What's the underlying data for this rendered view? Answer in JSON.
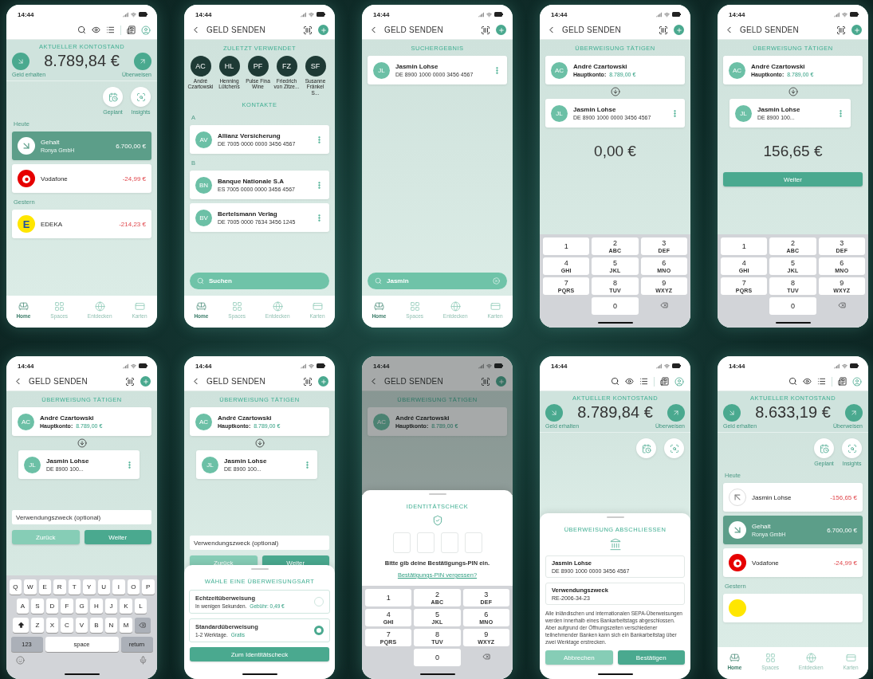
{
  "screens": [
    {
      "time": "14:44",
      "header": {
        "kind": "home"
      },
      "blocks": [
        {
          "kind": "balance",
          "label": "AKTUELLER KONTOSTAND",
          "amount": "8.789,84 €",
          "left_label": "Geld erhalten",
          "right_label": "Überweisen"
        },
        {
          "kind": "shortcuts",
          "items": [
            {
              "kind": "scheduled",
              "label": "Geplant"
            },
            {
              "kind": "insights",
              "label": "Insights"
            }
          ]
        },
        {
          "kind": "section_label",
          "text": "Heute"
        },
        {
          "kind": "transaction",
          "logo": {
            "kind": "arrow-in"
          },
          "name": "Gehalt",
          "sub": "Ronya GmbH",
          "amount": "6.700,00 €",
          "highlighted": true,
          "negative": false
        },
        {
          "kind": "transaction",
          "logo": {
            "kind": "vodafone"
          },
          "name": "Vodafone",
          "amount": "-24,99 €",
          "highlighted": false,
          "negative": true
        },
        {
          "kind": "section_label",
          "text": "Gestern"
        },
        {
          "kind": "transaction",
          "logo": {
            "kind": "edeka",
            "text": "E"
          },
          "name": "EDEKA",
          "amount": "-214,23 €",
          "highlighted": false,
          "negative": true
        }
      ],
      "tabbar": [
        {
          "label": "Home",
          "selected": true
        },
        {
          "label": "Spaces",
          "selected": false
        },
        {
          "label": "Entdecken",
          "selected": false
        },
        {
          "label": "Karten",
          "selected": false
        }
      ]
    },
    {
      "time": "14:44",
      "header": {
        "kind": "send",
        "title": "GELD SENDEN"
      },
      "blocks": [
        {
          "kind": "heading",
          "text": "ZULETZT VERWENDET"
        },
        {
          "kind": "recent",
          "items": [
            {
              "initials": "AC",
              "name": "André Czartowski"
            },
            {
              "initials": "HL",
              "name": "Henning Lütchens"
            },
            {
              "initials": "PF",
              "name": "Pulse Fina Wine"
            },
            {
              "initials": "FZ",
              "name": "Friedrich von Zitze..."
            },
            {
              "initials": "SF",
              "name": "Susanne Fränkel S..."
            }
          ]
        },
        {
          "kind": "heading",
          "text": "KONTAKTE"
        },
        {
          "kind": "section_label",
          "text": "A"
        },
        {
          "kind": "contact",
          "initials": "AV",
          "name": "Allianz Versicherung",
          "iban": "DE 7005 0000 0000 3456 4567",
          "menu": true,
          "indented": false
        },
        {
          "kind": "section_label",
          "text": "B"
        },
        {
          "kind": "contact",
          "initials": "BN",
          "name": "Banque Nationale S.A",
          "iban": "ES 7005 0000 0000 3456 4567",
          "menu": true,
          "indented": false
        },
        {
          "kind": "contact",
          "initials": "BV",
          "name": "Bertelsmann Verlag",
          "iban": "DE 7005 0000 7634 3456 1245",
          "menu": true,
          "indented": false
        },
        {
          "kind": "search",
          "placeholder": "Suchen"
        }
      ],
      "tabbar": [
        {
          "label": "Home",
          "selected": true
        },
        {
          "label": "Spaces",
          "selected": false
        },
        {
          "label": "Entdecken",
          "selected": false
        },
        {
          "label": "Karten",
          "selected": false
        }
      ]
    },
    {
      "time": "14:44",
      "header": {
        "kind": "send",
        "title": "GELD SENDEN"
      },
      "blocks": [
        {
          "kind": "heading",
          "text": "SUCHERGEBNIS"
        },
        {
          "kind": "contact",
          "initials": "JL",
          "name": "Jasmin Lohse",
          "iban": "DE 8900 1000 0000 3456 4567",
          "menu": true,
          "indented": false
        },
        {
          "kind": "search",
          "value": "Jasmin"
        }
      ],
      "tabbar": [
        {
          "label": "Home",
          "selected": true
        },
        {
          "label": "Spaces",
          "selected": false
        },
        {
          "label": "Entdecken",
          "selected": false
        },
        {
          "label": "Karten",
          "selected": false
        }
      ]
    },
    {
      "time": "14:44",
      "header": {
        "kind": "send",
        "title": "GELD SENDEN"
      },
      "blocks": [
        {
          "kind": "heading",
          "text": "ÜBERWEISUNG TÄTIGEN"
        },
        {
          "kind": "contact",
          "initials": "AC",
          "name": "André Czartowski",
          "account_label": "Hauptkonto:",
          "account_value": "8.789,00 €",
          "menu": false,
          "indented": false
        },
        {
          "kind": "swap"
        },
        {
          "kind": "contact",
          "initials": "JL",
          "name": "Jasmin Lohse",
          "iban": "DE 8900 1000 0000 3456 4567",
          "menu": true,
          "indented": false
        },
        {
          "kind": "amount",
          "text": "0,00 €"
        },
        {
          "kind": "numpad",
          "keys": [
            {
              "digit": "1"
            },
            {
              "digit": "2",
              "letters": "ABC"
            },
            {
              "digit": "3",
              "letters": "DEF"
            },
            {
              "digit": "4",
              "letters": "GHI"
            },
            {
              "digit": "5",
              "letters": "JKL"
            },
            {
              "digit": "6",
              "letters": "MNO"
            },
            {
              "digit": "7",
              "letters": "PQRS"
            },
            {
              "digit": "8",
              "letters": "TUV"
            },
            {
              "digit": "9",
              "letters": "WXYZ"
            },
            {
              "digit": "0"
            }
          ]
        }
      ]
    },
    {
      "time": "14:44",
      "header": {
        "kind": "send",
        "title": "GELD SENDEN"
      },
      "blocks": [
        {
          "kind": "heading",
          "text": "ÜBERWEISUNG TÄTIGEN"
        },
        {
          "kind": "contact",
          "initials": "AC",
          "name": "André Czartowski",
          "account_label": "Hauptkonto:",
          "account_value": "8.789,00 €",
          "menu": false,
          "indented": false
        },
        {
          "kind": "swap"
        },
        {
          "kind": "contact",
          "initials": "JL",
          "name": "Jasmin Lohse",
          "iban": "DE 8900 100...",
          "menu": true,
          "indented": true
        },
        {
          "kind": "amount",
          "text": "156,65 €"
        },
        {
          "kind": "button",
          "label": "Weiter"
        },
        {
          "kind": "numpad",
          "keys": [
            {
              "digit": "1"
            },
            {
              "digit": "2",
              "letters": "ABC"
            },
            {
              "digit": "3",
              "letters": "DEF"
            },
            {
              "digit": "4",
              "letters": "GHI"
            },
            {
              "digit": "5",
              "letters": "JKL"
            },
            {
              "digit": "6",
              "letters": "MNO"
            },
            {
              "digit": "7",
              "letters": "PQRS"
            },
            {
              "digit": "8",
              "letters": "TUV"
            },
            {
              "digit": "9",
              "letters": "WXYZ"
            },
            {
              "digit": "0"
            }
          ]
        }
      ]
    },
    {
      "time": "14:44",
      "header": {
        "kind": "send",
        "title": "GELD SENDEN"
      },
      "blocks": [
        {
          "kind": "heading",
          "text": "ÜBERWEISUNG TÄTIGEN"
        },
        {
          "kind": "contact",
          "initials": "AC",
          "name": "André Czartowski",
          "account_label": "Hauptkonto:",
          "account_value": "8.789,00 €",
          "menu": false,
          "indented": false
        },
        {
          "kind": "swap"
        },
        {
          "kind": "contact",
          "initials": "JL",
          "name": "Jasmin Lohse",
          "iban": "DE 8900 100...",
          "menu": true,
          "indented": true
        },
        {
          "kind": "field",
          "placeholder": "Verwendungszweck (optional)"
        },
        {
          "kind": "buttons",
          "items": [
            {
              "label": "Zurück",
              "primary": false
            },
            {
              "label": "Weiter",
              "primary": true
            }
          ]
        },
        {
          "kind": "keyboard",
          "rows": [
            [
              "Q",
              "W",
              "E",
              "R",
              "T",
              "Y",
              "U",
              "I",
              "O",
              "P"
            ],
            [
              "A",
              "S",
              "D",
              "F",
              "G",
              "H",
              "J",
              "K",
              "L"
            ],
            [
              "Z",
              "X",
              "C",
              "V",
              "B",
              "N",
              "M"
            ]
          ],
          "numbers": "123",
          "space": "space",
          "return": "return"
        }
      ]
    },
    {
      "time": "14:44",
      "header": {
        "kind": "send",
        "title": "GELD SENDEN"
      },
      "blocks": [
        {
          "kind": "heading",
          "text": "ÜBERWEISUNG TÄTIGEN"
        },
        {
          "kind": "contact",
          "initials": "AC",
          "name": "André Czartowski",
          "account_label": "Hauptkonto:",
          "account_value": "8.789,00 €",
          "menu": false,
          "indented": false
        },
        {
          "kind": "swap"
        },
        {
          "kind": "contact",
          "initials": "JL",
          "name": "Jasmin Lohse",
          "iban": "DE 8900 100...",
          "menu": true,
          "indented": true
        },
        {
          "kind": "field",
          "placeholder": "Verwendungszweck (optional)"
        },
        {
          "kind": "buttons",
          "items": [
            {
              "label": "Zurück",
              "primary": false
            },
            {
              "label": "Weiter",
              "primary": true
            }
          ]
        }
      ],
      "sheet": {
        "blocks": [
          {
            "kind": "heading",
            "text": "WÄHLE EINE ÜBERWEISUNGSART"
          },
          {
            "kind": "options",
            "items": [
              {
                "title": "Echtzeitüberweisung",
                "desc": "In wenigen Sekunden.",
                "note": "Gebühr: 0,49 €",
                "selected": false
              },
              {
                "title": "Standardüberweisung",
                "desc": "1-2 Werktage.",
                "note": "Gratis",
                "selected": true
              }
            ]
          },
          {
            "kind": "button",
            "label": "Zum Identitätscheck"
          }
        ]
      }
    },
    {
      "time": "14:44",
      "dimmed": true,
      "header": {
        "kind": "send",
        "title": "GELD SENDEN"
      },
      "blocks": [
        {
          "kind": "heading",
          "text": "ÜBERWEISUNG TÄTIGEN"
        },
        {
          "kind": "contact",
          "initials": "AC",
          "name": "André Czartowski",
          "account_label": "Hauptkonto:",
          "account_value": "8.789,00 €",
          "menu": false,
          "indented": false
        }
      ],
      "sheet": {
        "blocks": [
          {
            "kind": "heading",
            "text": "IDENTITÄTSCHECK"
          },
          {
            "kind": "shield"
          },
          {
            "kind": "pin",
            "fields": [
              {
                "filled": false
              },
              {
                "filled": false
              },
              {
                "filled": false
              },
              {
                "filled": false
              }
            ]
          },
          {
            "kind": "text",
            "text": "Bitte gib deine Bestätigungs-PIN ein."
          },
          {
            "kind": "link",
            "text": "Bestätigungs-PIN vergessen?"
          },
          {
            "kind": "numpad",
            "keys": [
              {
                "digit": "1"
              },
              {
                "digit": "2",
                "letters": "ABC"
              },
              {
                "digit": "3",
                "letters": "DEF"
              },
              {
                "digit": "4",
                "letters": "GHI"
              },
              {
                "digit": "5",
                "letters": "JKL"
              },
              {
                "digit": "6",
                "letters": "MNO"
              },
              {
                "digit": "7",
                "letters": "PQRS"
              },
              {
                "digit": "8",
                "letters": "TUV"
              },
              {
                "digit": "9",
                "letters": "WXYZ"
              },
              {
                "digit": "0"
              }
            ]
          }
        ]
      }
    },
    {
      "time": "14:44",
      "header": {
        "kind": "home"
      },
      "blocks": [
        {
          "kind": "balance",
          "label": "AKTUELLER KONTOSTAND",
          "amount": "8.789,84 €",
          "left_label": "Geld erhalten",
          "right_label": "Überweisen"
        },
        {
          "kind": "shortcuts",
          "items": [
            {
              "kind": "scheduled"
            },
            {
              "kind": "insights"
            }
          ]
        }
      ],
      "sheet": {
        "blocks": [
          {
            "kind": "heading",
            "text": "ÜBERWEISUNG ABSCHLIESSEN"
          },
          {
            "kind": "bank"
          },
          {
            "kind": "info",
            "title": "Jasmin Lohse",
            "value": "DE 8900 1000 0000 3456 4567"
          },
          {
            "kind": "info",
            "title": "Verwendungszweck",
            "value": "RE-2006-34-23"
          },
          {
            "kind": "paragraph",
            "text": "Alle inländischen und internationalen SEPA-Überweisungen werden innerhalb eines Bankarbeitstags abgeschlossen. Aber aufgrund der Öffnungszeiten verschiedener teilnehmender Banken kann sich ein Bankarbeitstag über zwei Werktage erstrecken."
          },
          {
            "kind": "buttons",
            "items": [
              {
                "label": "Abbrechen",
                "primary": false
              },
              {
                "label": "Bestätigen",
                "primary": true
              }
            ]
          }
        ]
      }
    },
    {
      "time": "14:44",
      "header": {
        "kind": "home"
      },
      "blocks": [
        {
          "kind": "balance",
          "label": "AKTUELLER KONTOSTAND",
          "amount": "8.633,19 €",
          "left_label": "Geld erhalten",
          "right_label": "Überweisen"
        },
        {
          "kind": "shortcuts",
          "items": [
            {
              "kind": "scheduled",
              "label": "Geplant"
            },
            {
              "kind": "insights",
              "label": "Insights"
            }
          ]
        },
        {
          "kind": "section_label",
          "text": "Heute"
        },
        {
          "kind": "transaction",
          "logo": {
            "kind": "arrow-out"
          },
          "name": "Jasmin Lohse",
          "amount": "-156,65 €",
          "highlighted": false,
          "negative": true
        },
        {
          "kind": "transaction",
          "logo": {
            "kind": "arrow-in"
          },
          "name": "Gehalt",
          "sub": "Ronya GmbH",
          "amount": "6.700,00 €",
          "highlighted": true,
          "negative": false
        },
        {
          "kind": "transaction",
          "logo": {
            "kind": "vodafone"
          },
          "name": "Vodafone",
          "amount": "-24,99 €",
          "highlighted": false,
          "negative": true
        },
        {
          "kind": "section_label",
          "text": "Gestern"
        },
        {
          "kind": "transaction",
          "logo": {
            "kind": "edeka"
          },
          "highlighted": false
        }
      ],
      "tabbar": [
        {
          "label": "Home",
          "selected": true
        },
        {
          "label": "Spaces",
          "selected": false
        },
        {
          "label": "Entdecken",
          "selected": false
        },
        {
          "label": "Karten",
          "selected": false
        }
      ]
    }
  ]
}
